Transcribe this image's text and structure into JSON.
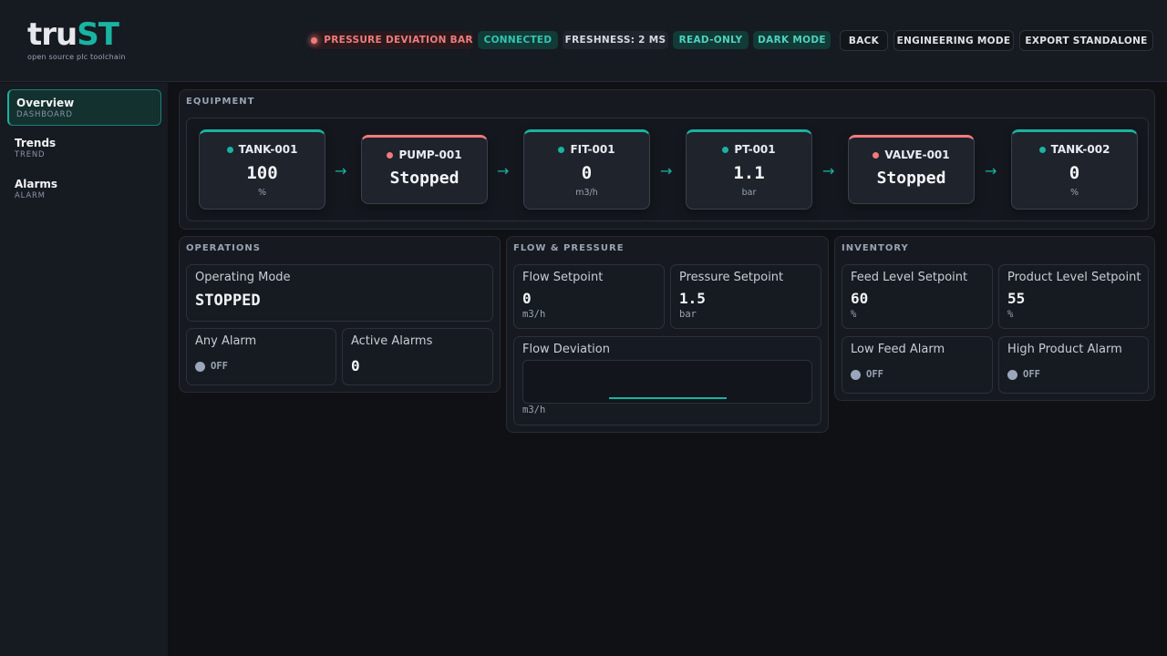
{
  "app": {
    "logo_part1": "tru",
    "logo_part2": "ST",
    "logo_tagline": "open source plc toolchain"
  },
  "header": {
    "alarm_pill": "PRESSURE DEVIATION BAR",
    "connection": "CONNECTED",
    "freshness": "FRESHNESS: 2 MS",
    "access": "READ-ONLY",
    "theme": "DARK MODE",
    "back_label": "BACK",
    "engineering_label": "ENGINEERING MODE",
    "export_label": "EXPORT STANDALONE"
  },
  "sidebar": {
    "items": [
      {
        "label": "Overview",
        "sub": "DASHBOARD",
        "active": true
      },
      {
        "label": "Trends",
        "sub": "TREND",
        "active": false
      },
      {
        "label": "Alarms",
        "sub": "ALARM",
        "active": false
      }
    ]
  },
  "equipment": {
    "title": "EQUIPMENT",
    "units": [
      {
        "name": "TANK-001",
        "value": "100",
        "unit": "%",
        "status": "ok"
      },
      {
        "name": "PUMP-001",
        "value": "Stopped",
        "unit": "",
        "status": "bad"
      },
      {
        "name": "FIT-001",
        "value": "0",
        "unit": "m3/h",
        "status": "ok"
      },
      {
        "name": "PT-001",
        "value": "1.1",
        "unit": "bar",
        "status": "ok"
      },
      {
        "name": "VALVE-001",
        "value": "Stopped",
        "unit": "",
        "status": "bad"
      },
      {
        "name": "TANK-002",
        "value": "0",
        "unit": "%",
        "status": "ok"
      }
    ],
    "arrow": "→"
  },
  "operations": {
    "title": "OPERATIONS",
    "mode_label": "Operating Mode",
    "mode_value": "STOPPED",
    "any_alarm_label": "Any Alarm",
    "any_alarm_state": "OFF",
    "active_alarms_label": "Active Alarms",
    "active_alarms_value": "0"
  },
  "flow_pressure": {
    "title": "FLOW & PRESSURE",
    "flow_sp_label": "Flow Setpoint",
    "flow_sp_value": "0",
    "flow_sp_unit": "m3/h",
    "pressure_sp_label": "Pressure Setpoint",
    "pressure_sp_value": "1.5",
    "pressure_sp_unit": "bar",
    "flow_dev_label": "Flow Deviation",
    "flow_dev_unit": "m3/h"
  },
  "inventory": {
    "title": "INVENTORY",
    "feed_sp_label": "Feed Level Setpoint",
    "feed_sp_value": "60",
    "feed_sp_unit": "%",
    "product_sp_label": "Product Level Setpoint",
    "product_sp_value": "55",
    "product_sp_unit": "%",
    "low_feed_label": "Low Feed Alarm",
    "low_feed_state": "OFF",
    "high_product_label": "High Product Alarm",
    "high_product_state": "OFF"
  },
  "colors": {
    "accent": "#19b3a1",
    "alarm": "#f07b7b",
    "background": "#0f1115",
    "indicator_off": "#9aa6bb"
  }
}
